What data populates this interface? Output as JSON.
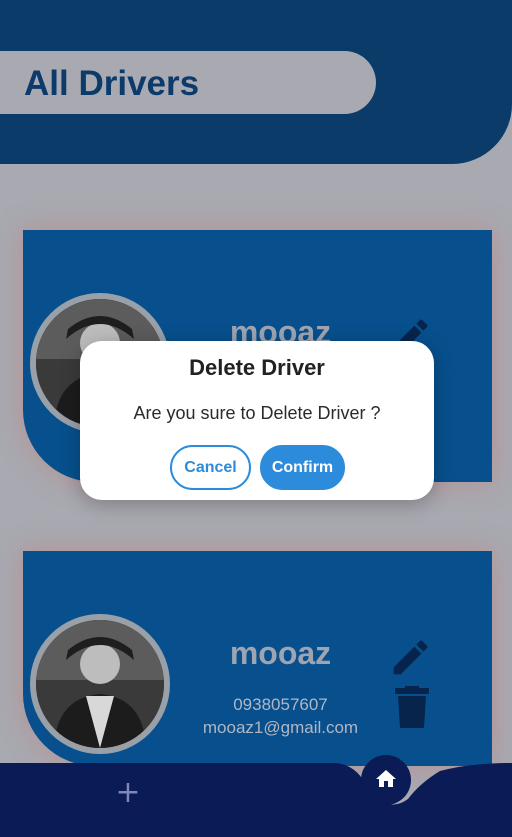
{
  "header": {
    "title": "All Drivers"
  },
  "drivers": [
    {
      "name": "mooaz",
      "phone": "",
      "email": ""
    },
    {
      "name": "mooaz",
      "phone": "0938057607",
      "email": "mooaz1@gmail.com"
    }
  ],
  "dialog": {
    "title": "Delete Driver",
    "message": "Are you sure to Delete Driver ?",
    "cancel_label": "Cancel",
    "confirm_label": "Confirm"
  },
  "bottom_nav": {
    "add_label": "+",
    "home_icon": "home-icon"
  },
  "colors": {
    "primary": "#07508d",
    "header": "#0a3b69",
    "nav": "#0b1b55",
    "accent": "#2c8cdb"
  }
}
